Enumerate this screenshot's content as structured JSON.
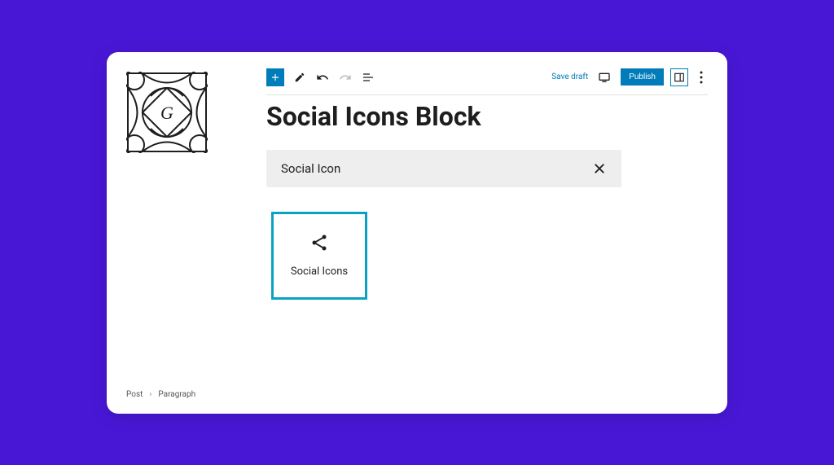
{
  "toolbar": {
    "save_draft": "Save draft",
    "publish": "Publish"
  },
  "page": {
    "title": "Social Icons Block"
  },
  "search": {
    "query": "Social Icon"
  },
  "block_result": {
    "label": "Social Icons"
  },
  "breadcrumb": {
    "root": "Post",
    "current": "Paragraph"
  }
}
